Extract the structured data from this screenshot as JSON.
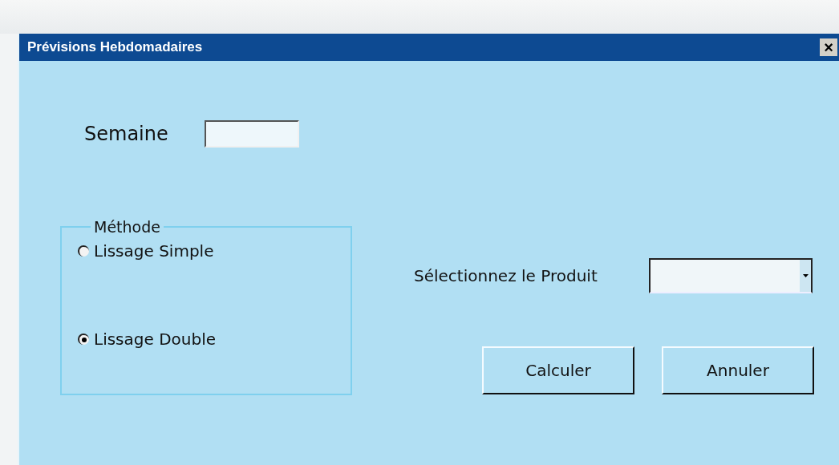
{
  "window": {
    "title": "Prévisions Hebdomadaires",
    "close": "×"
  },
  "week": {
    "label": "Semaine"
  },
  "method": {
    "legend": "Méthode",
    "options": [
      {
        "label": "Lissage Simple",
        "selected": false
      },
      {
        "label": "Lissage Double",
        "selected": true
      }
    ]
  },
  "product": {
    "label": "Sélectionnez le Produit"
  },
  "buttons": [
    "Calculer",
    "Annuler"
  ]
}
